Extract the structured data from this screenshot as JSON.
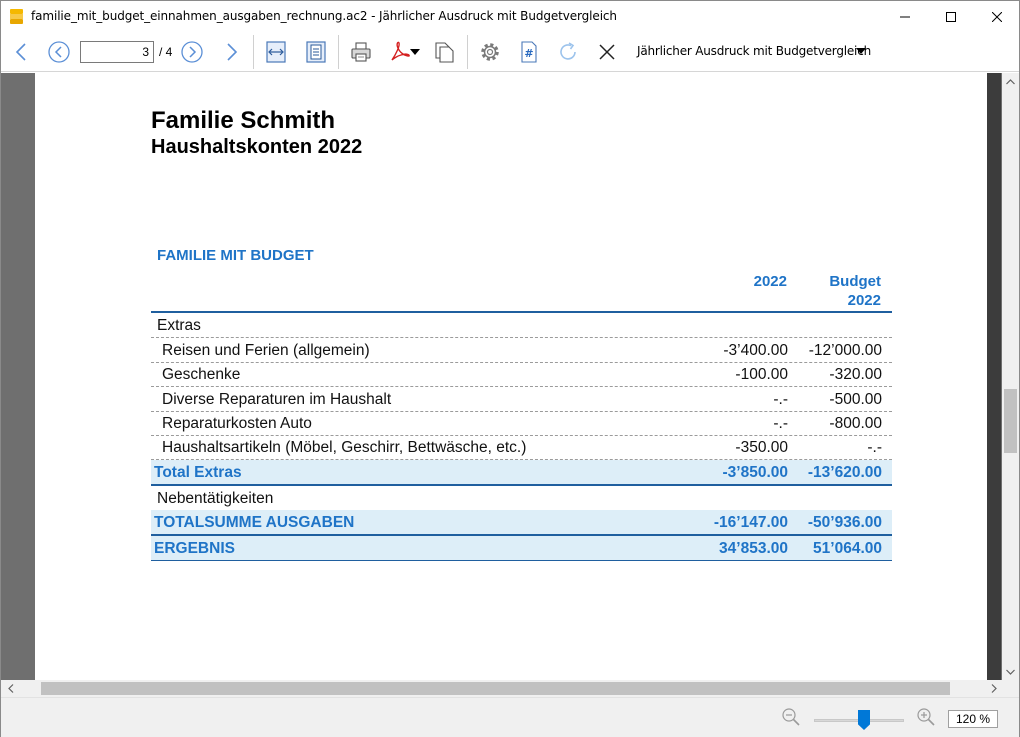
{
  "window": {
    "title": "familie_mit_budget_einnahmen_ausgaben_rechnung.ac2 - Jährlicher Ausdruck mit Budgetvergleich"
  },
  "toolbar": {
    "page_current": "3",
    "page_total": "/ 4",
    "layout_name": "Jährlicher Ausdruck mit Budgetvergleich"
  },
  "report": {
    "title": "Familie Schmith",
    "subtitle": "Haushaltskonten 2022",
    "section": "FAMILIE MIT BUDGET",
    "col1_header": "2022",
    "col2_header_line1": "Budget",
    "col2_header_line2": "2022",
    "rows": [
      {
        "label": "Extras",
        "v1": "",
        "v2": ""
      },
      {
        "label": "Reisen und Ferien (allgemein)",
        "v1": "-3’400.00",
        "v2": "-12’000.00"
      },
      {
        "label": "Geschenke",
        "v1": "-100.00",
        "v2": "-320.00"
      },
      {
        "label": "Diverse Reparaturen im Haushalt",
        "v1": "-.-",
        "v2": "-500.00"
      },
      {
        "label": "Reparaturkosten Auto",
        "v1": "-.-",
        "v2": "-800.00"
      },
      {
        "label": "Haushaltsartikeln (Möbel, Geschirr, Bettwäsche, etc.)",
        "v1": "-350.00",
        "v2": "-.-"
      },
      {
        "label": "Total Extras",
        "v1": "-3’850.00",
        "v2": "-13’620.00"
      },
      {
        "label": "Nebentätigkeiten",
        "v1": "",
        "v2": ""
      },
      {
        "label": "TOTALSUMME AUSGABEN",
        "v1": "-16’147.00",
        "v2": "-50’936.00"
      },
      {
        "label": "ERGEBNIS",
        "v1": "34’853.00",
        "v2": "51’064.00"
      }
    ]
  },
  "statusbar": {
    "zoom": "120 %",
    "zoom_level_percent": 55
  },
  "colors": {
    "accent": "#1f74c7",
    "total_bg": "#ddeef8",
    "preview_bg": "#6f6f6f"
  },
  "icons": [
    "app-icon",
    "back-icon",
    "prev-page-icon",
    "next-page-icon",
    "forward-icon",
    "fit-width-icon",
    "fit-page-icon",
    "print-icon",
    "pdf-icon",
    "copy-icon",
    "settings-icon",
    "hash-icon",
    "refresh-icon",
    "close-icon",
    "zoom-out-icon",
    "zoom-in-icon"
  ]
}
